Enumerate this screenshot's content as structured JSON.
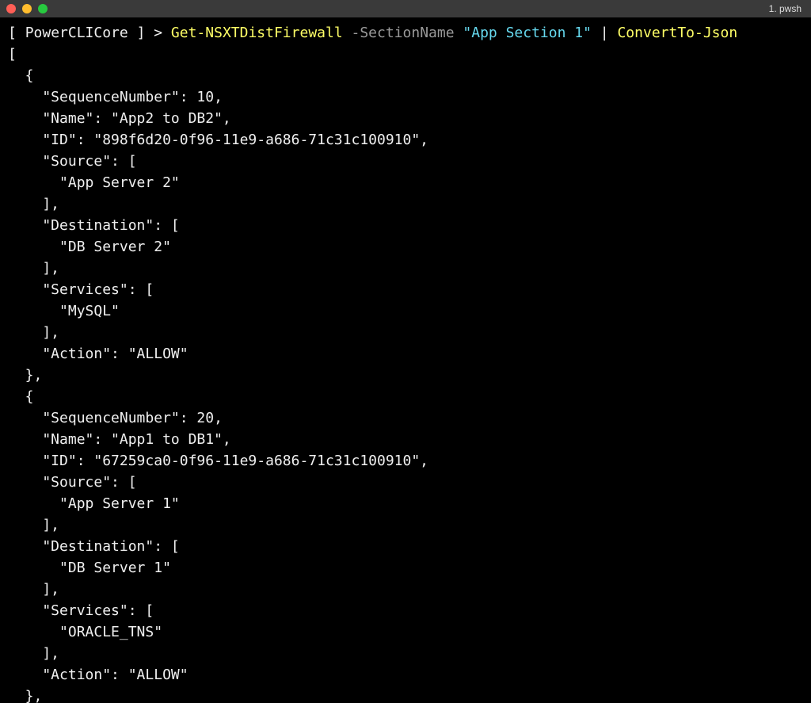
{
  "window": {
    "title": "1. pwsh"
  },
  "prompt": {
    "open": "[ ",
    "context": "PowerCLICore",
    "close": " ] > "
  },
  "command": {
    "cmdlet": "Get-NSXTDistFirewall",
    "param_flag": " -SectionName ",
    "param_value": "\"App Section 1\"",
    "pipe": " | ",
    "cmdlet2": "ConvertTo-Json"
  },
  "output": "[\n  {\n    \"SequenceNumber\": 10,\n    \"Name\": \"App2 to DB2\",\n    \"ID\": \"898f6d20-0f96-11e9-a686-71c31c100910\",\n    \"Source\": [\n      \"App Server 2\"\n    ],\n    \"Destination\": [\n      \"DB Server 2\"\n    ],\n    \"Services\": [\n      \"MySQL\"\n    ],\n    \"Action\": \"ALLOW\"\n  },\n  {\n    \"SequenceNumber\": 20,\n    \"Name\": \"App1 to DB1\",\n    \"ID\": \"67259ca0-0f96-11e9-a686-71c31c100910\",\n    \"Source\": [\n      \"App Server 1\"\n    ],\n    \"Destination\": [\n      \"DB Server 1\"\n    ],\n    \"Services\": [\n      \"ORACLE_TNS\"\n    ],\n    \"Action\": \"ALLOW\"\n  },"
}
